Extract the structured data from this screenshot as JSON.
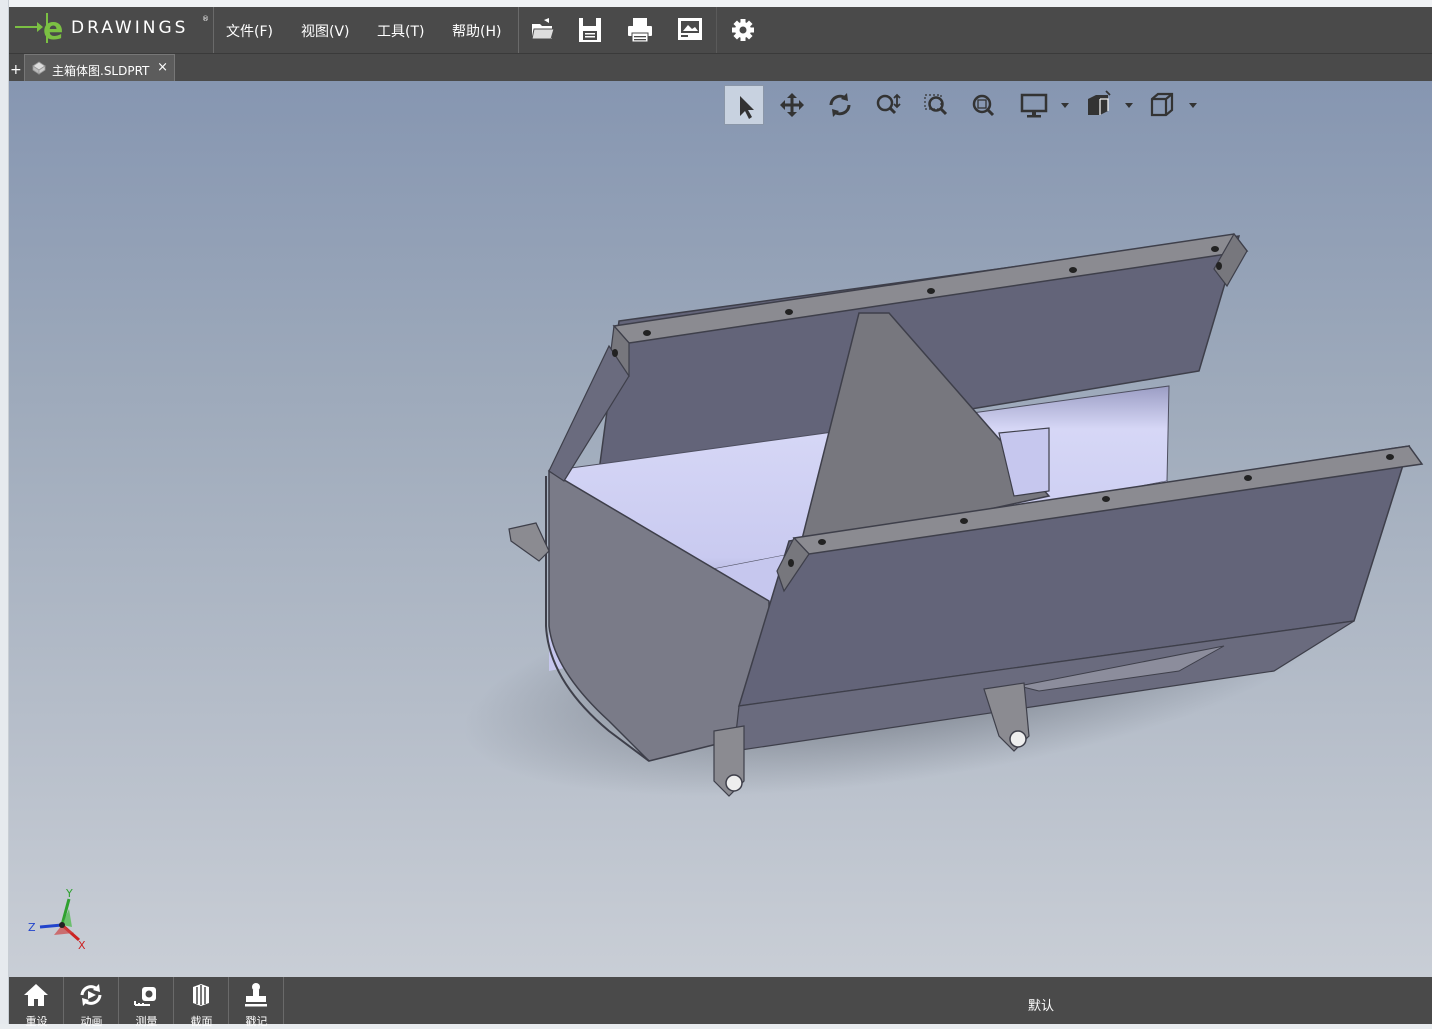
{
  "app": {
    "logo_letter": "e",
    "logo_text": "DRAWINGS",
    "logo_mark": "®"
  },
  "menu": {
    "items": [
      {
        "label": "文件(F)"
      },
      {
        "label": "视图(V)"
      },
      {
        "label": "工具(T)"
      },
      {
        "label": "帮助(H)"
      }
    ]
  },
  "toolbar": {
    "buttons": [
      {
        "icon": "open-folder-icon"
      },
      {
        "icon": "save-icon"
      },
      {
        "icon": "print-icon"
      },
      {
        "icon": "markup-icon"
      },
      {
        "icon": "gear-icon"
      }
    ]
  },
  "tabs": {
    "new_tab": "+",
    "items": [
      {
        "label": "主箱体图.SLDPRT",
        "close": "×",
        "icon": "part-file-icon"
      }
    ]
  },
  "view_toolbar": {
    "buttons": [
      {
        "icon": "select-arrow-icon",
        "active": true
      },
      {
        "icon": "pan-icon"
      },
      {
        "icon": "rotate-icon"
      },
      {
        "icon": "zoom-icon"
      },
      {
        "icon": "zoom-to-area-icon"
      },
      {
        "icon": "zoom-to-fit-icon"
      },
      {
        "icon": "display-style-icon"
      },
      {
        "icon": "view-orientation-icon"
      },
      {
        "icon": "standard-view-icon"
      }
    ]
  },
  "triad": {
    "x": "X",
    "y": "Y",
    "z": "Z"
  },
  "bottom_bar": {
    "buttons": [
      {
        "label": "重设",
        "icon": "home-icon"
      },
      {
        "label": "动画",
        "icon": "animate-icon"
      },
      {
        "label": "测量",
        "icon": "measure-icon"
      },
      {
        "label": "截面",
        "icon": "section-icon"
      },
      {
        "label": "戳记",
        "icon": "stamp-icon"
      }
    ],
    "configuration": "默认"
  },
  "colors": {
    "chrome": "#4a4a4a",
    "brand_green": "#7bc043",
    "viewport_top": "#8696b1",
    "viewport_bottom": "#c9ced6"
  }
}
